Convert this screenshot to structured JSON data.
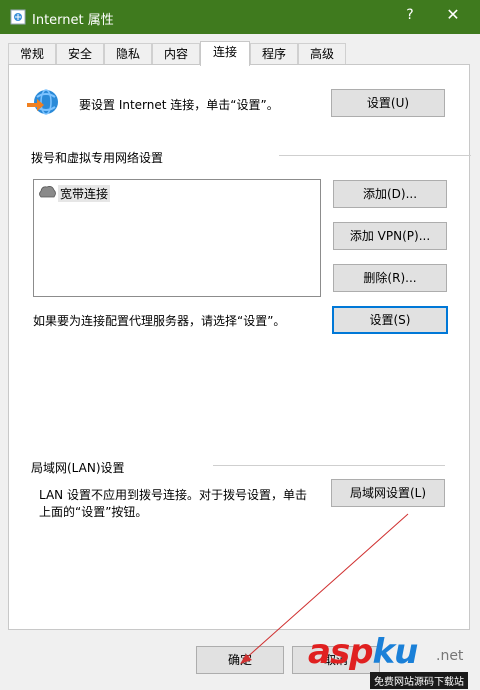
{
  "window": {
    "title": "Internet 属性",
    "help_label": "?",
    "close_label": "✕"
  },
  "tabs": [
    "常规",
    "安全",
    "隐私",
    "内容",
    "连接",
    "程序",
    "高级"
  ],
  "active_tab": "连接",
  "setup": {
    "text": "要设置 Internet 连接，单击“设置”。",
    "button": "设置(U)"
  },
  "dialup": {
    "heading": "拨号和虚拟专用网络设置",
    "items": [
      {
        "label": "宽带连接"
      }
    ],
    "add_button": "添加(D)...",
    "add_vpn_button": "添加 VPN(P)...",
    "remove_button": "删除(R)...",
    "proxy_text": "如果要为连接配置代理服务器，请选择“设置”。",
    "settings_button": "设置(S)"
  },
  "lan": {
    "heading": "局域网(LAN)设置",
    "text_line1": "LAN 设置不应用到拨号连接。对于拨号设置，单击",
    "text_line2": "上面的“设置”按钮。",
    "button": "局域网设置(L)"
  },
  "footer": {
    "ok_button": "确定",
    "cancel_button": "取消"
  },
  "watermark": {
    "brand_a": "asp",
    "brand_b": "ku",
    "domain": ".net",
    "slogan": "免费网站源码下载站"
  },
  "colors": {
    "titlebar": "#3f7a1e",
    "focus_border": "#0078d7",
    "annotation_arrow": "#d03030"
  }
}
